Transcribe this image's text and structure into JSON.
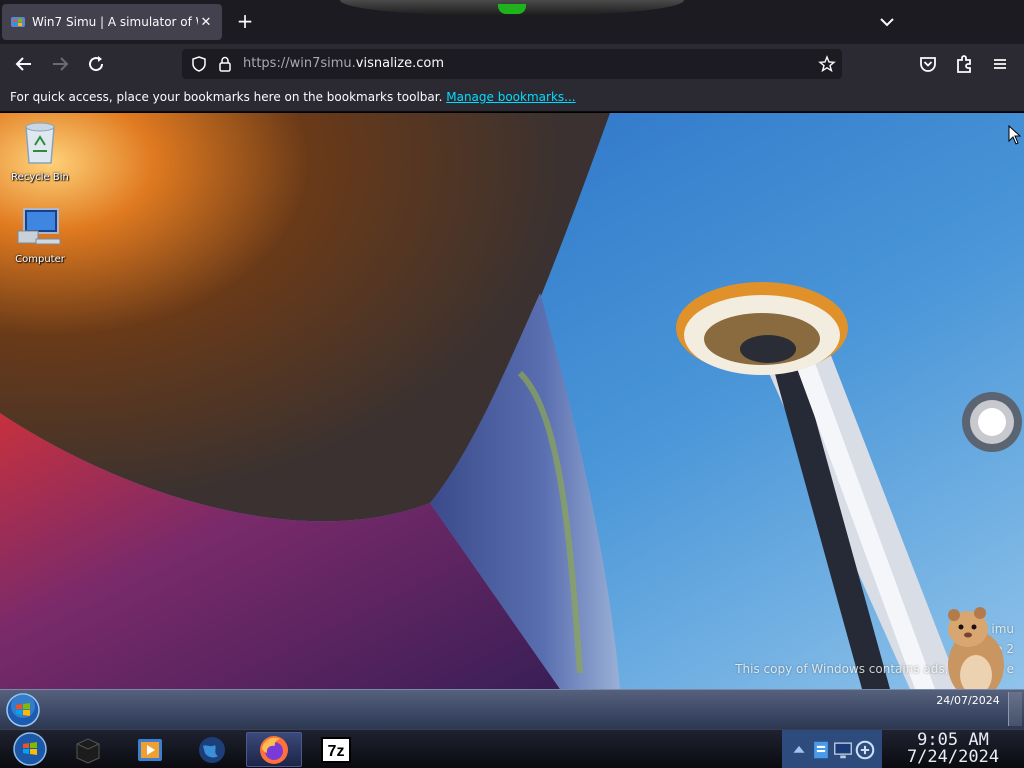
{
  "browser": {
    "tab": {
      "title": "Win7 Simu | A simulator of Wi",
      "close": "✕"
    },
    "new_tab": "+",
    "url": {
      "host_prefix": "https://win7simu.",
      "host_main": "visnalize.com"
    },
    "bookmarks_bar": {
      "text": "For quick access, place your bookmarks here on the bookmarks toolbar.",
      "link": "Manage bookmarks..."
    }
  },
  "desktop": {
    "icons": [
      {
        "label": "Recycle Bin",
        "icon": "recycle-bin-icon"
      },
      {
        "label": "Computer",
        "icon": "computer-icon"
      }
    ],
    "watermark": {
      "line1": "imu",
      "line2": "Ve          2",
      "line3": "This copy of Windows contains ads, click her         e"
    }
  },
  "sim_taskbar": {
    "tray_icons": [
      "flag-icon",
      "network-signal-icon",
      "battery-icon"
    ],
    "clock_time": "",
    "clock_date": "24/07/2024"
  },
  "host_taskbar": {
    "apps": [
      {
        "name": "terminal-app",
        "active": false
      },
      {
        "name": "media-player-app",
        "active": false
      },
      {
        "name": "globe-app",
        "active": false
      },
      {
        "name": "firefox-app",
        "active": true
      },
      {
        "name": "7zip-app",
        "active": false,
        "label": "7z"
      }
    ],
    "tray_icons": [
      "arrow-up-icon",
      "document-icon",
      "monitor-icon",
      "network-icon"
    ],
    "clock_time": "9:05 AM",
    "clock_date": "7/24/2024"
  },
  "colors": {
    "chrome_dark": "#1c1b22",
    "toolbar": "#2b2a33",
    "link": "#00ddff",
    "sky": "#3f88d0"
  }
}
